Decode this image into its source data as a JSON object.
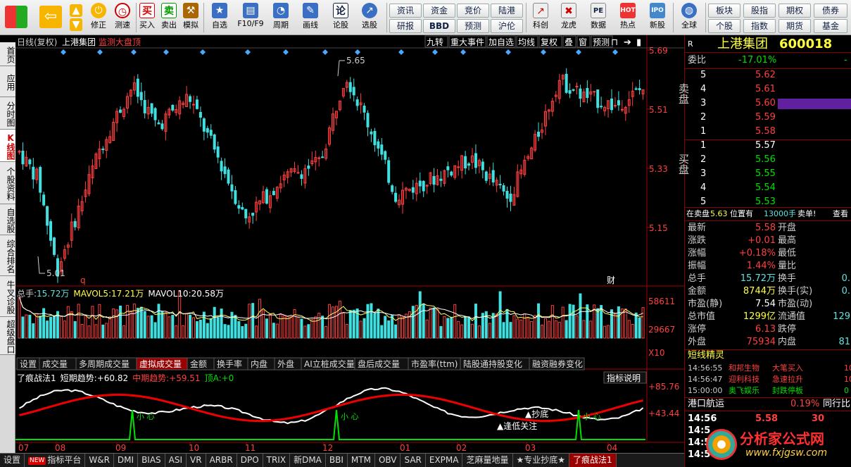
{
  "toolbar": {
    "buttons": [
      {
        "label": "",
        "icon": "windows-logo-icon"
      },
      {
        "label": "",
        "icon": "back-arrow-icon"
      },
      {
        "label": "",
        "icon": "up-down-arrows-icon"
      },
      {
        "label": "修正",
        "icon": "power-icon"
      },
      {
        "label": "测速",
        "icon": "clock-icon"
      },
      {
        "label": "买入",
        "icon": "buy-icon"
      },
      {
        "label": "卖出",
        "icon": "sell-icon"
      },
      {
        "label": "模拟",
        "icon": "hammer-icon"
      },
      {
        "label": "自选",
        "icon": "star-icon"
      },
      {
        "label": "F10/F9",
        "icon": "f10-icon"
      },
      {
        "label": "周期",
        "icon": "period-icon"
      },
      {
        "label": "画线",
        "icon": "pen-icon"
      },
      {
        "label": "论股",
        "icon": "talk-icon"
      },
      {
        "label": "选股",
        "icon": "pick-stock-icon"
      }
    ],
    "grid_row1": [
      "资讯",
      "资金",
      "竞价",
      "陆港"
    ],
    "grid_row2": [
      "研报",
      "BBD",
      "预测",
      "沪伦"
    ],
    "buttons2": [
      {
        "label": "科创",
        "icon": "chart-icon"
      },
      {
        "label": "龙虎",
        "icon": "tiger-icon"
      },
      {
        "label": "数据",
        "icon": "pe-icon"
      },
      {
        "label": "热点",
        "icon": "hot-icon"
      },
      {
        "label": "新股",
        "icon": "ipo-icon"
      },
      {
        "label": "全球",
        "icon": "globe-icon"
      }
    ],
    "grid2_row1": [
      "板块",
      "股指",
      "期权",
      "债券"
    ],
    "grid2_row2": [
      "个股",
      "指数",
      "期货",
      "基金"
    ]
  },
  "left_tabs": [
    "首页",
    "应用",
    "分时图",
    "K线图",
    "个股资料",
    "自选股",
    "综合排名",
    "牛叉诊股",
    "超级盘口"
  ],
  "left_tab_active": 3,
  "chart": {
    "header_label": "日线(复权)",
    "stock_name": "上港集团",
    "monitor_label": "监测大盘顶",
    "top_buttons": [
      "九转",
      "重大事件",
      "加自选",
      "均线",
      "复权",
      "叠",
      "窗",
      "预测"
    ],
    "price_ticks": [
      "5.69",
      "5.51",
      "5.33",
      "5.15"
    ],
    "high_label": "5.65",
    "low_label": "5.01",
    "marker_q": "q",
    "marker_cai": "财",
    "volume_header": {
      "total_label": "总手:",
      "total": "15.72万",
      "ma5_label": "MAVOL5:",
      "ma5": "17.21万",
      "ma10_label": "MAVOL10:",
      "ma10": "20.58万"
    },
    "volume_ticks": [
      "58611",
      "29667",
      "X10"
    ],
    "indicator_tabs": [
      "设置",
      "成交量",
      "多周期成交量",
      "虚拟成交量",
      "金额",
      "换手率",
      "内盘",
      "外盘",
      "AI立桩成交量",
      "盘后成交量",
      "市盈率(ttm)",
      "陆股通持股变化",
      "融资融券变化"
    ],
    "indicator_tab_active": 3,
    "indicator_help": "指标说明",
    "indicator_header": {
      "name": "了痕战法1",
      "short_label": "短期趋势:",
      "short_val": "+60.82",
      "mid_label": "中期趋势:",
      "mid_val": "+59.51",
      "top_label": "顶A:",
      "top_val": "+0"
    },
    "indicator_ticks": [
      "+85.76",
      "+43.44"
    ],
    "signal_labels": [
      "小 心",
      "小 心",
      "小 心"
    ],
    "annotations": [
      "▲逢低关注",
      "▲抄底"
    ],
    "month_labels": [
      "07",
      "08",
      "09",
      "10",
      "11",
      "12",
      "01",
      "02",
      "03",
      "04"
    ]
  },
  "bottom_tabs": [
    "设置",
    "指标平台",
    "W&R",
    "DMI",
    "BIAS",
    "ASI",
    "VR",
    "ARBR",
    "DPO",
    "TRIX",
    "新DMA",
    "BBI",
    "MTM",
    "OBV",
    "SAR",
    "EXPMA",
    "芝麻量地量",
    "★专业抄底★",
    "了痕战法1"
  ],
  "bottom_new_badge": "NEW",
  "bottom_tab_active": 18,
  "quote": {
    "r_label": "R",
    "name": "上港集团",
    "code": "600018",
    "weibi_label": "委比",
    "weibi": "-17.01%",
    "weibi_trunc": "-",
    "sell_label": "卖盘",
    "buy_label": "买盘",
    "sell": [
      {
        "lvl": "5",
        "price": "5.62"
      },
      {
        "lvl": "4",
        "price": "5.61"
      },
      {
        "lvl": "3",
        "price": "5.60"
      },
      {
        "lvl": "2",
        "price": "5.59"
      },
      {
        "lvl": "1",
        "price": "5.58"
      }
    ],
    "buy": [
      {
        "lvl": "1",
        "price": "5.57"
      },
      {
        "lvl": "2",
        "price": "5.56"
      },
      {
        "lvl": "3",
        "price": "5.55"
      },
      {
        "lvl": "4",
        "price": "5.54"
      },
      {
        "lvl": "5",
        "price": "5.53"
      }
    ],
    "order_note": {
      "prefix": "在卖盘",
      "price": "5.63",
      "mid": "位置有",
      "qty": "13000手",
      "sell": "卖单!",
      "view": "查看"
    },
    "stats": [
      {
        "l": "最新",
        "v": "5.58",
        "l2": "开盘",
        "v2": ""
      },
      {
        "l": "涨跌",
        "v": "+0.01",
        "l2": "最高",
        "v2": ""
      },
      {
        "l": "涨幅",
        "v": "+0.18%",
        "l2": "最低",
        "v2": ""
      },
      {
        "l": "振幅",
        "v": "1.44%",
        "l2": "量比",
        "v2": ""
      },
      {
        "l": "总手",
        "v": "15.72万",
        "l2": "换手",
        "v2": "0."
      },
      {
        "l": "金额",
        "v": "8744万",
        "l2": "换手(实)",
        "v2": "0."
      },
      {
        "l": "市盈(静)",
        "v": "7.54",
        "l2": "市盈(动)",
        "v2": ""
      },
      {
        "l": "总市值",
        "v": "1299亿",
        "l2": "流通值",
        "v2": "129"
      },
      {
        "l": "涨停",
        "v": "6.13",
        "l2": "跌停",
        "v2": ""
      },
      {
        "l": "外盘",
        "v": "75934",
        "l2": "内盘",
        "v2": "81"
      }
    ],
    "elves_title": "短线精灵",
    "elves": [
      {
        "t": "14:56:55",
        "n": "和邦生物",
        "e": "大笔买入",
        "x": "10"
      },
      {
        "t": "14:56:47",
        "n": "迎利科技",
        "e": "急速拉升",
        "x": "10"
      },
      {
        "t": "15:00:00",
        "n": "奥飞娱乐",
        "e": "封跌停板",
        "x": "0"
      }
    ],
    "sector": {
      "name": "港口航运",
      "pct": "0.19%",
      "rank": "同行比"
    },
    "ticks": [
      {
        "t": "14:56",
        "p": "5.58",
        "q": "30"
      },
      {
        "t": "14:5",
        "p": "",
        "q": ""
      },
      {
        "t": "14:5",
        "p": "",
        "q": ""
      },
      {
        "t": "14:5",
        "p": "",
        "q": ""
      }
    ],
    "logo_text": "分析家公式网",
    "logo_url": "www.fxjgsw.com"
  },
  "colors": {
    "up": "#ff4040",
    "down": "#40e0e0",
    "bg": "#000000",
    "accent": "#800000"
  }
}
